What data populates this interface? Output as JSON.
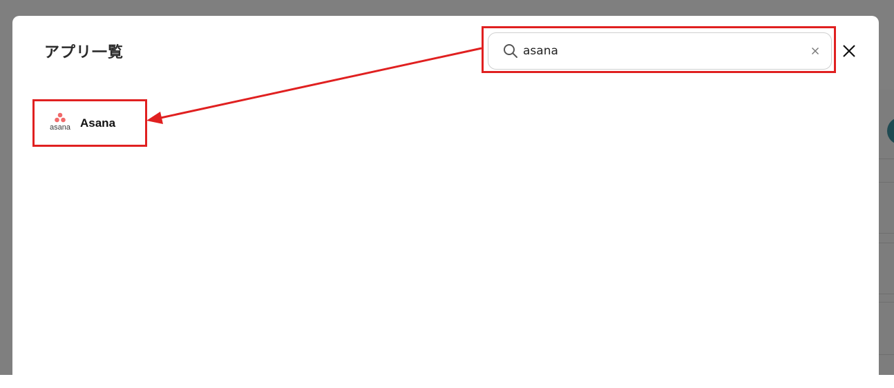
{
  "modal": {
    "title": "アプリ一覧"
  },
  "search": {
    "value": "asana",
    "placeholder": ""
  },
  "results": [
    {
      "logo_text": "asana",
      "label": "Asana"
    }
  ],
  "colors": {
    "highlight": "#e02020",
    "overlay": "#7f7f7f",
    "asana_brand": "#f06a6a"
  },
  "icons": {
    "search": "search-icon",
    "clear": "clear-icon",
    "close": "close-icon",
    "asana": "asana-logo-icon"
  }
}
